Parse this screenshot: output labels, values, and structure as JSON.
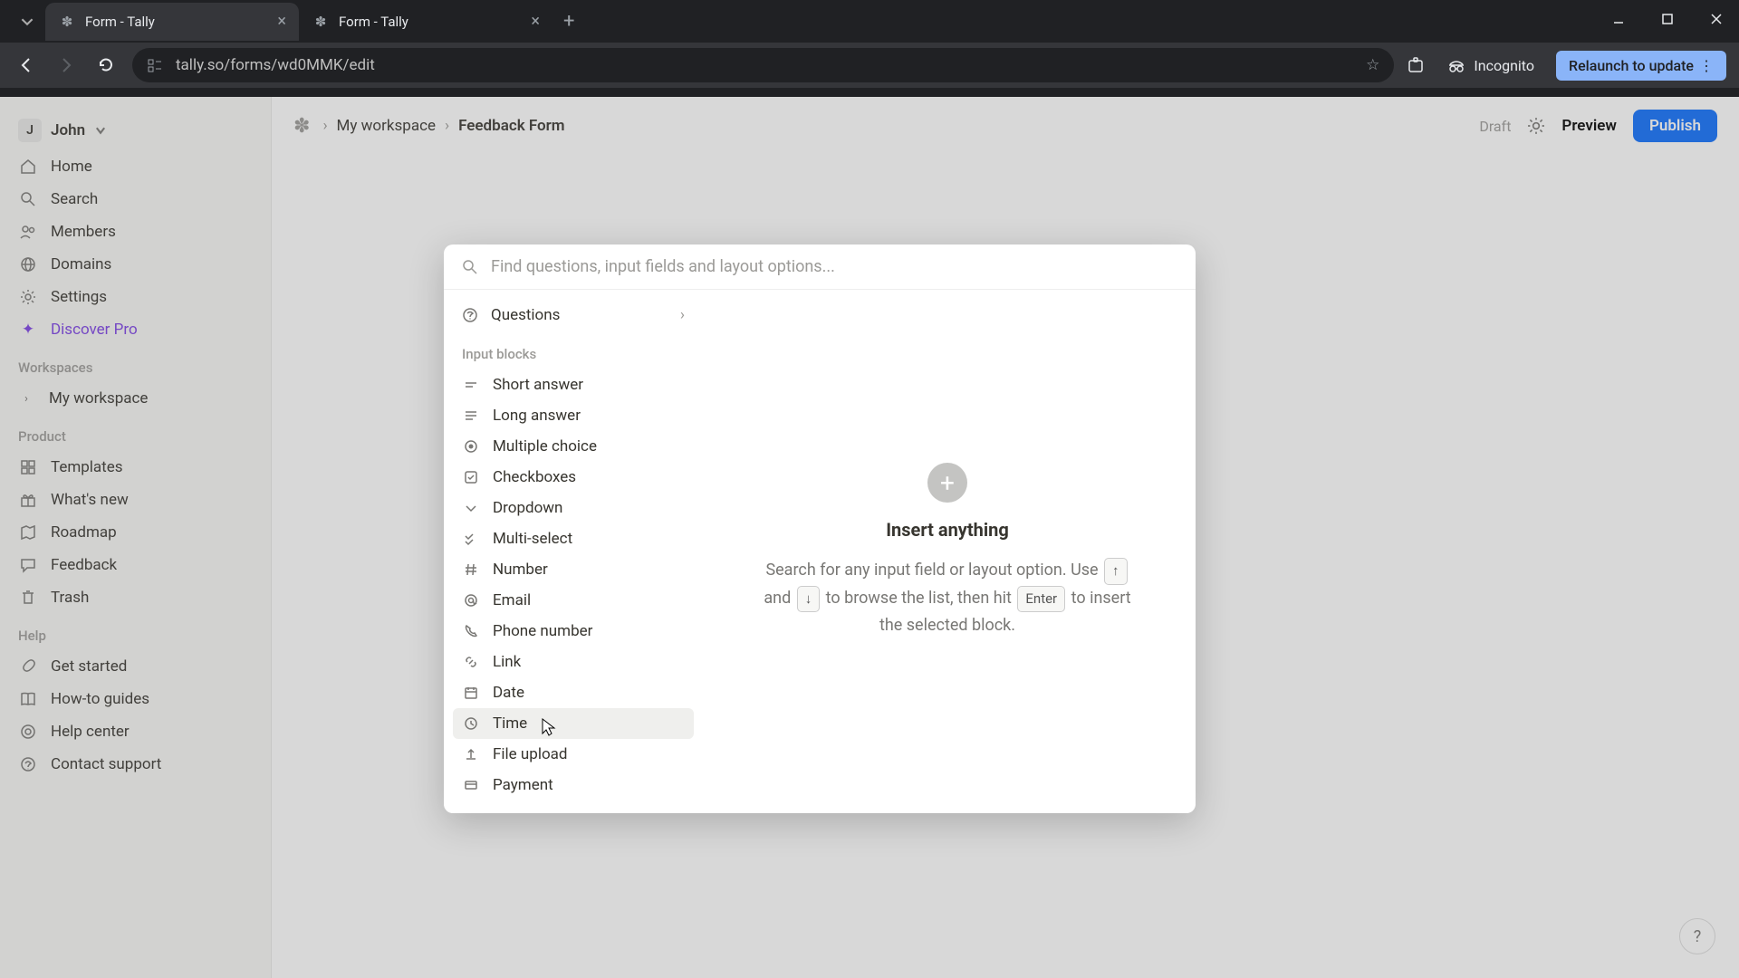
{
  "browser": {
    "tabs": [
      {
        "title": "Form - Tally",
        "active": true
      },
      {
        "title": "Form - Tally",
        "active": false
      }
    ],
    "url": "tally.so/forms/wd0MMK/edit",
    "incognito_label": "Incognito",
    "relaunch_label": "Relaunch to update"
  },
  "user": {
    "initial": "J",
    "name": "John"
  },
  "sidebar": {
    "nav": [
      {
        "icon": "home",
        "label": "Home"
      },
      {
        "icon": "search",
        "label": "Search"
      },
      {
        "icon": "members",
        "label": "Members"
      },
      {
        "icon": "domains",
        "label": "Domains"
      },
      {
        "icon": "settings",
        "label": "Settings"
      },
      {
        "icon": "sparkle",
        "label": "Discover Pro",
        "pro": true
      }
    ],
    "workspaces_label": "Workspaces",
    "workspace": "My workspace",
    "product_label": "Product",
    "product": [
      {
        "icon": "templates",
        "label": "Templates"
      },
      {
        "icon": "gift",
        "label": "What's new"
      },
      {
        "icon": "map",
        "label": "Roadmap"
      },
      {
        "icon": "chat",
        "label": "Feedback"
      },
      {
        "icon": "trash",
        "label": "Trash"
      }
    ],
    "help_label": "Help",
    "help": [
      {
        "icon": "rocket",
        "label": "Get started"
      },
      {
        "icon": "book",
        "label": "How-to guides"
      },
      {
        "icon": "life",
        "label": "Help center"
      },
      {
        "icon": "support",
        "label": "Contact support"
      }
    ]
  },
  "breadcrumb": {
    "workspace": "My workspace",
    "form": "Feedback Form"
  },
  "topbar": {
    "draft": "Draft",
    "preview": "Preview",
    "publish": "Publish"
  },
  "modal": {
    "search_placeholder": "Find questions, input fields and layout options...",
    "questions_label": "Questions",
    "section_label": "Input blocks",
    "blocks": [
      {
        "icon": "short",
        "label": "Short answer"
      },
      {
        "icon": "long",
        "label": "Long answer"
      },
      {
        "icon": "mc",
        "label": "Multiple choice"
      },
      {
        "icon": "check",
        "label": "Checkboxes"
      },
      {
        "icon": "drop",
        "label": "Dropdown"
      },
      {
        "icon": "multi",
        "label": "Multi-select"
      },
      {
        "icon": "num",
        "label": "Number"
      },
      {
        "icon": "email",
        "label": "Email"
      },
      {
        "icon": "phone",
        "label": "Phone number"
      },
      {
        "icon": "link",
        "label": "Link"
      },
      {
        "icon": "date",
        "label": "Date"
      },
      {
        "icon": "time",
        "label": "Time",
        "hover": true
      },
      {
        "icon": "file",
        "label": "File upload"
      },
      {
        "icon": "pay",
        "label": "Payment"
      }
    ],
    "right": {
      "title": "Insert anything",
      "desc_prefix": "Search for any input field or layout option. Use ",
      "desc_mid": " and ",
      "desc_mid2": " to browse the list, then hit ",
      "desc_suffix": " to insert the selected block.",
      "key_up": "↑",
      "key_down": "↓",
      "key_enter": "Enter"
    }
  },
  "help_fab": "?"
}
